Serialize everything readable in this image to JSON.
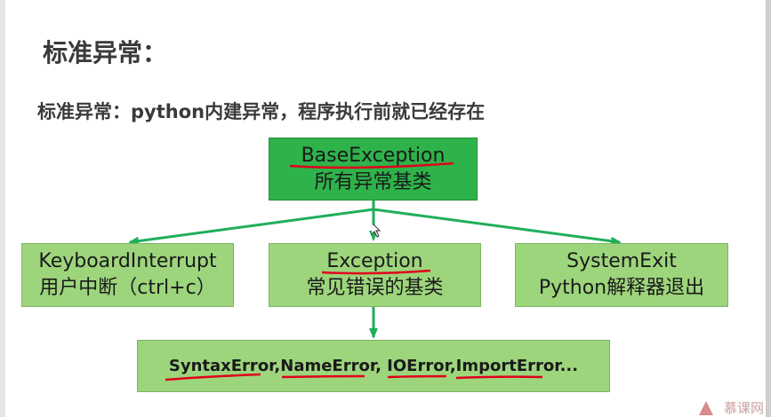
{
  "slide": {
    "title": "标准异常：",
    "subtitle": "标准异常：python内建异常，程序执行前就已经存在"
  },
  "diagram": {
    "root": {
      "name": "BaseException",
      "desc": "所有异常基类"
    },
    "children": [
      {
        "name": "KeyboardInterrupt",
        "desc": "用户中断（ctrl+c）"
      },
      {
        "name": "Exception",
        "desc": "常见错误的基类"
      },
      {
        "name": "SystemExit",
        "desc": "Python解释器退出"
      }
    ],
    "leaf": {
      "text": "SyntaxError,NameError, IOError,ImportError..."
    }
  },
  "watermark": "慕课网",
  "colors": {
    "root_box": "#2eb34a",
    "child_box": "#9dd57c",
    "arrow": "#1fae5b",
    "annotation": "#e0001b"
  }
}
